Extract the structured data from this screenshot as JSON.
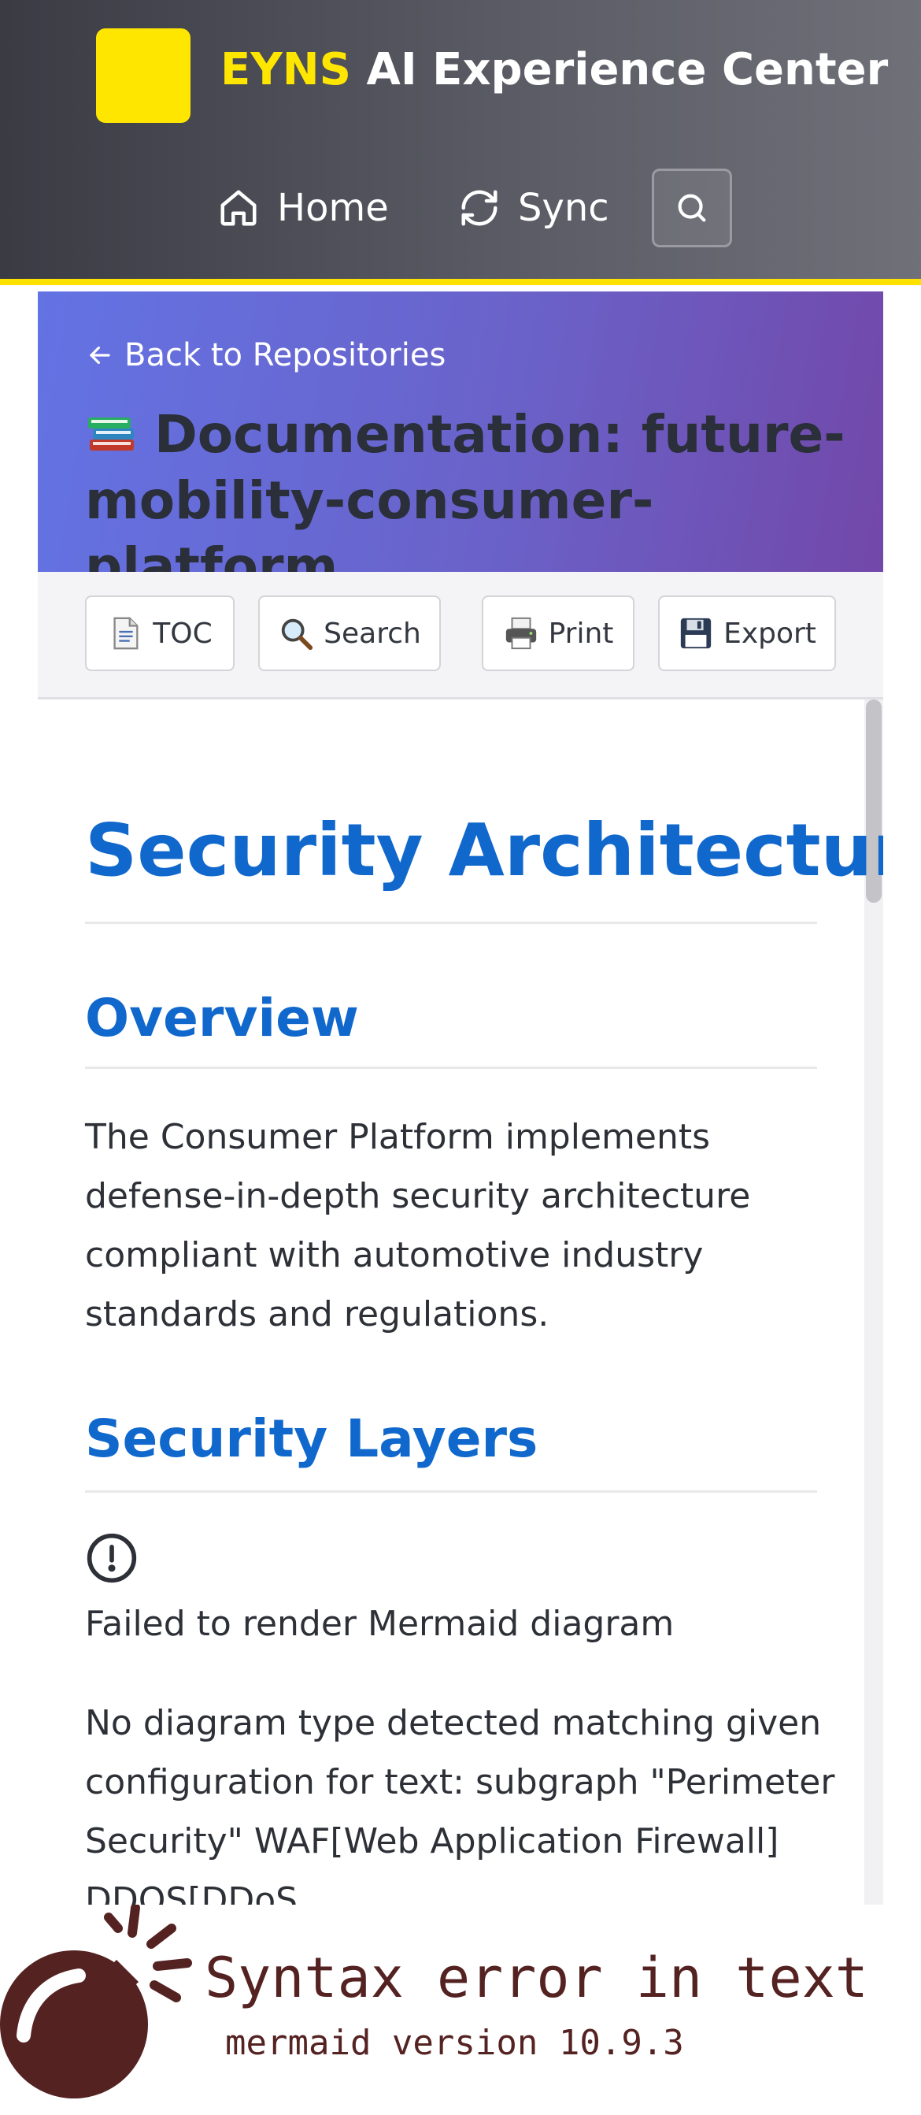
{
  "header": {
    "brand_accent": "EYNS",
    "brand_rest": " AI Experience Center",
    "nav": {
      "home_label": "Home",
      "sync_label": "Sync"
    },
    "accent_color": "#ffe600"
  },
  "doc": {
    "back_link": "Back to Repositories",
    "title": "Documentation: future-mobility-consumer-platform",
    "title_icon": "books-icon"
  },
  "toolbar": {
    "toc_label": "TOC",
    "search_label": "Search",
    "print_label": "Print",
    "export_label": "Export"
  },
  "content": {
    "h1": "Security Architecture",
    "overview_heading": "Overview",
    "overview_text": "The Consumer Platform implements defense-in-depth security architecture compliant with automotive industry standards and regulations.",
    "layers_heading": "Security Layers",
    "render_error": "Failed to render Mermaid diagram",
    "error_detail": "No diagram type detected matching given configuration for text: subgraph \"Perimeter Security\" WAF[Web Application Firewall] DDOS[DDoS"
  },
  "mermaid_error": {
    "title": "Syntax error in text",
    "version": "mermaid version 10.9.3",
    "color": "#552222"
  }
}
